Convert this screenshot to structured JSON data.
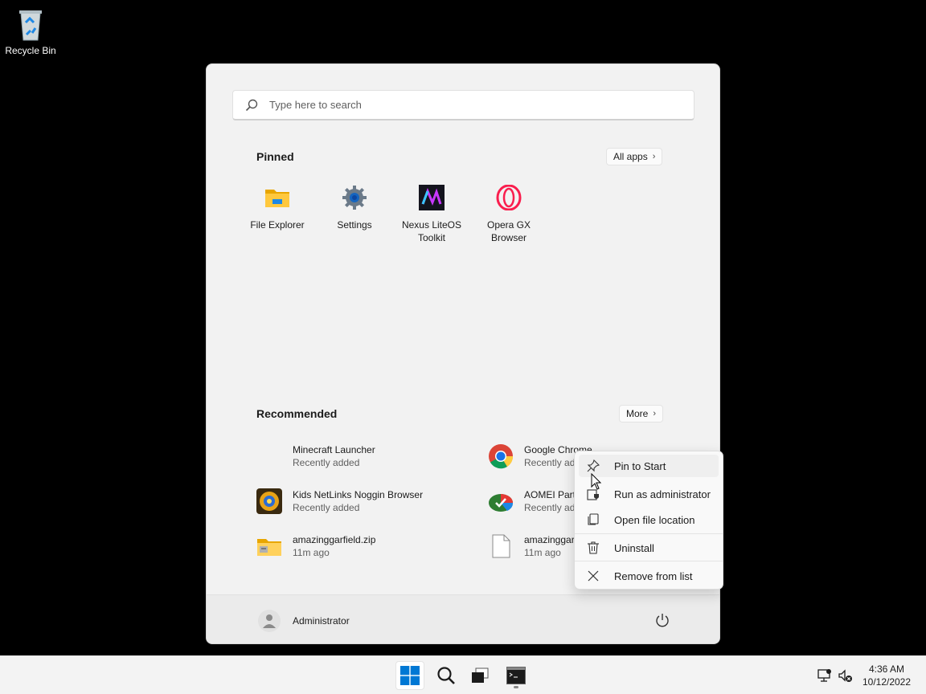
{
  "desktop": {
    "recycle_bin_label": "Recycle Bin"
  },
  "start_menu": {
    "search_placeholder": "Type here to search",
    "pinned_title": "Pinned",
    "all_apps_label": "All apps",
    "pinned_apps": [
      {
        "label": "File Explorer",
        "icon": "folder-icon"
      },
      {
        "label": "Settings",
        "icon": "gear-icon"
      },
      {
        "label": "Nexus LiteOS Toolkit",
        "icon": "nexus-icon"
      },
      {
        "label": "Opera GX Browser",
        "icon": "opera-icon"
      }
    ],
    "recommended_title": "Recommended",
    "more_label": "More",
    "recommended": [
      {
        "name": "Minecraft Launcher",
        "sub": "Recently added"
      },
      {
        "name": "Google Chrome",
        "sub": "Recently added"
      },
      {
        "name": "Kids NetLinks Noggin Browser",
        "sub": "Recently added"
      },
      {
        "name": "AOMEI Part",
        "sub": "Recently add"
      },
      {
        "name": "amazinggarfield.zip",
        "sub": "11m ago"
      },
      {
        "name": "amazinggar",
        "sub": "11m ago"
      }
    ],
    "user_name": "Administrator"
  },
  "context_menu": {
    "items": [
      {
        "label": "Pin to Start",
        "icon": "pin-icon"
      },
      {
        "label": "Run as administrator",
        "icon": "shield-icon"
      },
      {
        "label": "Open file location",
        "icon": "copy-icon"
      },
      {
        "label": "Uninstall",
        "icon": "trash-icon"
      },
      {
        "label": "Remove from list",
        "icon": "close-icon"
      }
    ]
  },
  "taskbar": {
    "time": "4:36 AM",
    "date": "10/12/2022"
  },
  "colors": {
    "windows_blue": "#0078d4",
    "start_bg": "#f2f2f2",
    "taskbar_bg": "#f3f3f3"
  }
}
